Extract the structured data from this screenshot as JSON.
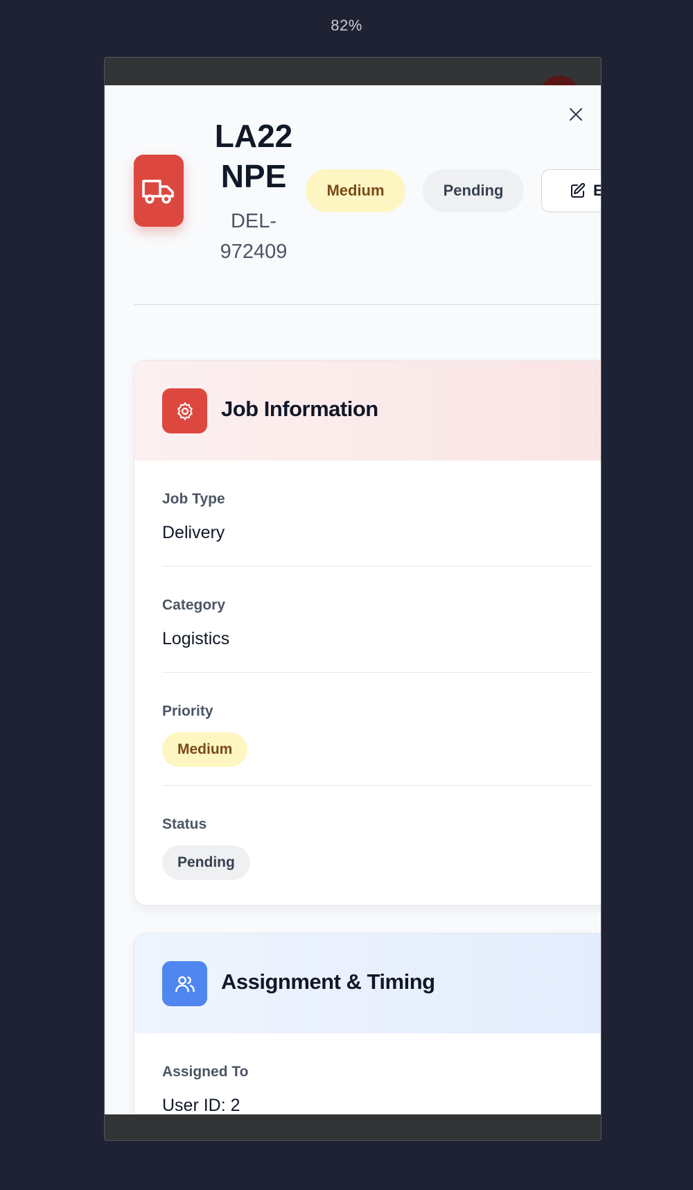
{
  "zoom": "82%",
  "header": {
    "plate": "LA22 NPE",
    "reference": "DEL-972409",
    "priority_badge": "Medium",
    "status_badge": "Pending",
    "edit_label": "Edit"
  },
  "job_information": {
    "title": "Job Information",
    "fields": {
      "job_type_label": "Job Type",
      "job_type_value": "Delivery",
      "category_label": "Category",
      "category_value": "Logistics",
      "priority_label": "Priority",
      "priority_value": "Medium",
      "status_label": "Status",
      "status_value": "Pending"
    }
  },
  "assignment": {
    "title": "Assignment & Timing",
    "assigned_label": "Assigned To",
    "assigned_value": "User ID: 2"
  },
  "colors": {
    "background": "#1e2233",
    "red_accent": "#dc4840",
    "blue_accent": "#4f86f0",
    "medium_badge_bg": "#fef6c2",
    "pending_badge_bg": "#eff0f2"
  },
  "icons": {
    "close": "close-icon",
    "truck": "truck-icon",
    "edit": "edit-icon",
    "gear": "gear-icon",
    "users": "users-icon"
  }
}
